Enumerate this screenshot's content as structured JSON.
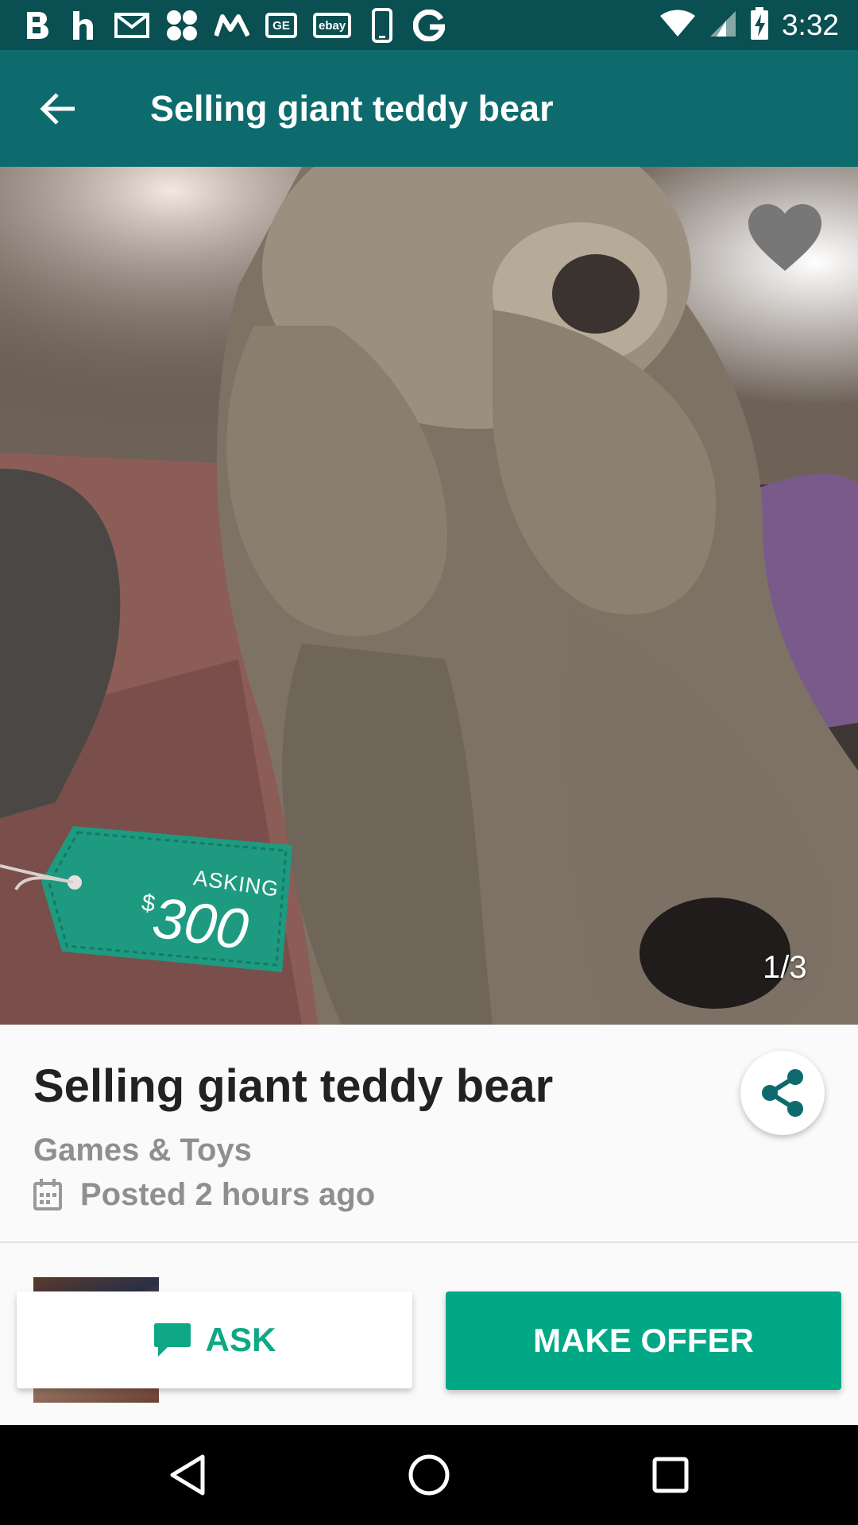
{
  "status_bar": {
    "time": "3:32",
    "notification_icons": [
      "b-icon",
      "h-icon",
      "gmail-icon",
      "dots-icon",
      "m-icon",
      "ge-icon",
      "ebay-icon",
      "phone-icon",
      "g-icon"
    ],
    "ebay_text": "ebay",
    "ge_text": "GE"
  },
  "app_bar": {
    "title": "Selling giant teddy bear"
  },
  "photo": {
    "counter": "1/3",
    "tag_label": "ASKING",
    "tag_currency": "$",
    "tag_amount": "300"
  },
  "listing": {
    "title": "Selling giant teddy bear",
    "category": "Games & Toys",
    "posted": "Posted 2 hours ago"
  },
  "actions": {
    "ask_label": "ASK",
    "offer_label": "MAKE OFFER"
  },
  "colors": {
    "status_bar": "#0a4f51",
    "app_bar": "#0d6b6d",
    "accent": "#00a885",
    "tag": "#1e9a80"
  }
}
